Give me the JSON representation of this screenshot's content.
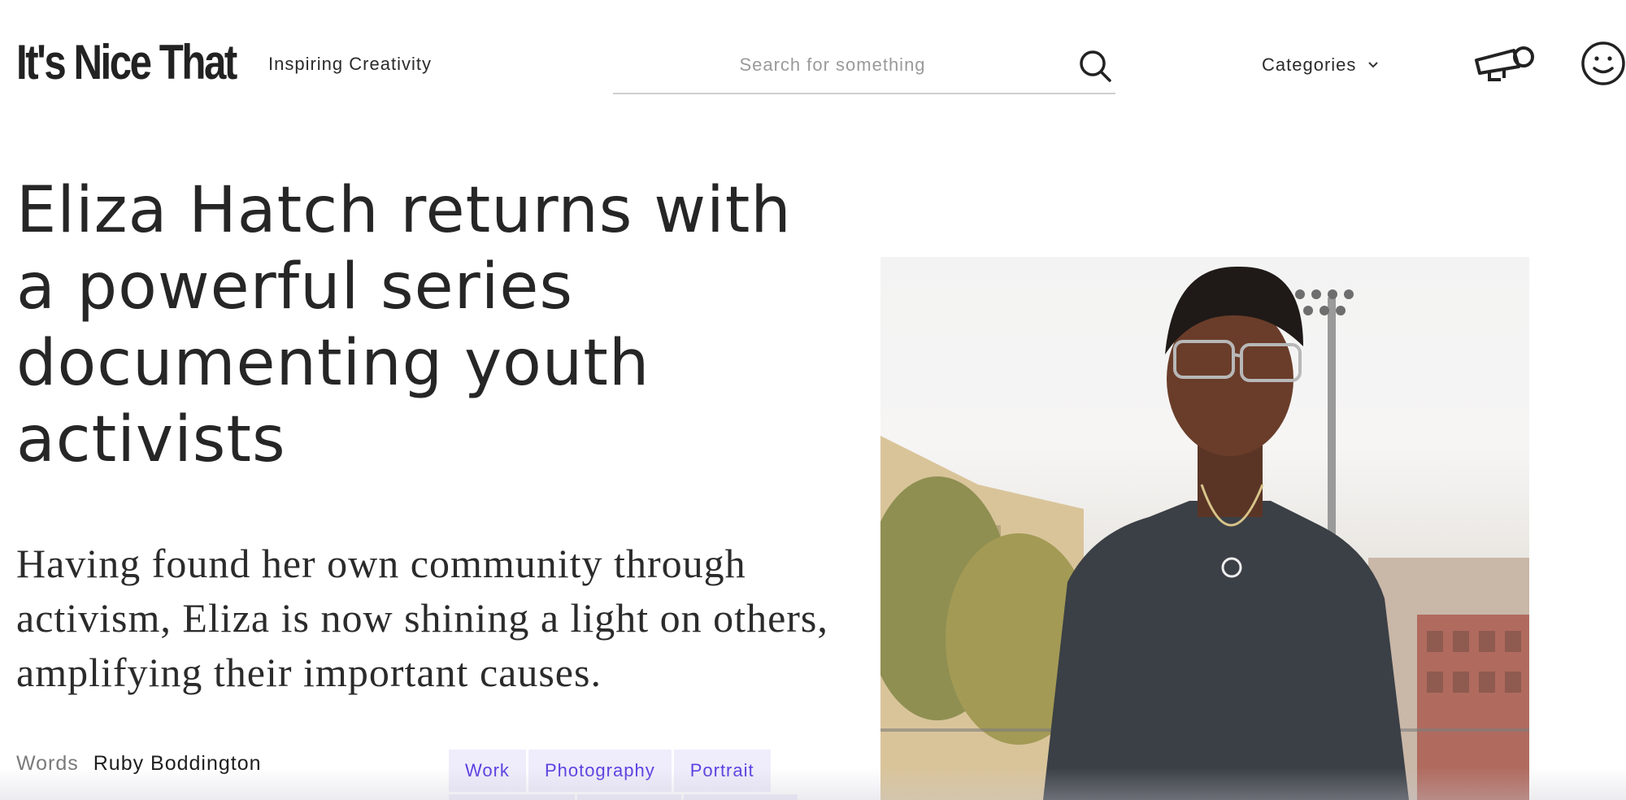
{
  "header": {
    "logo_text": "It's Nice That",
    "tagline": "Inspiring Creativity",
    "search_placeholder": "Search for something",
    "categories_label": "Categories",
    "icons": {
      "search": "search-icon",
      "categories_chevron": "chevron-down-icon",
      "megaphone": "megaphone-icon",
      "account": "smiley-icon"
    }
  },
  "article": {
    "headline": "Eliza Hatch returns with a powerful series documenting youth activists",
    "standfirst": "Having found her own community through activism, Eliza is now shining a light on others, amplifying their important causes.",
    "byline_label": "Words",
    "byline_author": "Ruby Boddington",
    "tags": [
      "Work",
      "Photography",
      "Portrait"
    ]
  },
  "colors": {
    "tag_background": "#efecfb",
    "tag_text": "#5a3ee0",
    "text_primary": "#262626",
    "text_muted": "#7a7a7a"
  }
}
